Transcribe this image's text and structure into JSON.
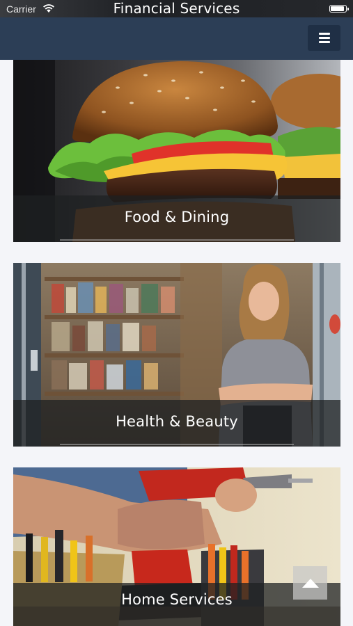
{
  "status_bar": {
    "carrier": "Carrier",
    "title": "Financial Services"
  },
  "header": {
    "menu_icon": "hamburger-menu-icon"
  },
  "categories": [
    {
      "label": "Food & Dining",
      "image": "burger-photo"
    },
    {
      "label": "Health & Beauty",
      "image": "shop-woman-photo"
    },
    {
      "label": "Home Services",
      "image": "power-drill-tools-photo"
    }
  ],
  "scroll_top": {
    "icon": "arrow-up-icon"
  },
  "colors": {
    "header_bg": "#2c3e56",
    "menu_button_bg": "#1f2f45",
    "page_bg": "#f4f5f9",
    "label_bar_bg": "rgba(30,32,34,0.74)"
  }
}
